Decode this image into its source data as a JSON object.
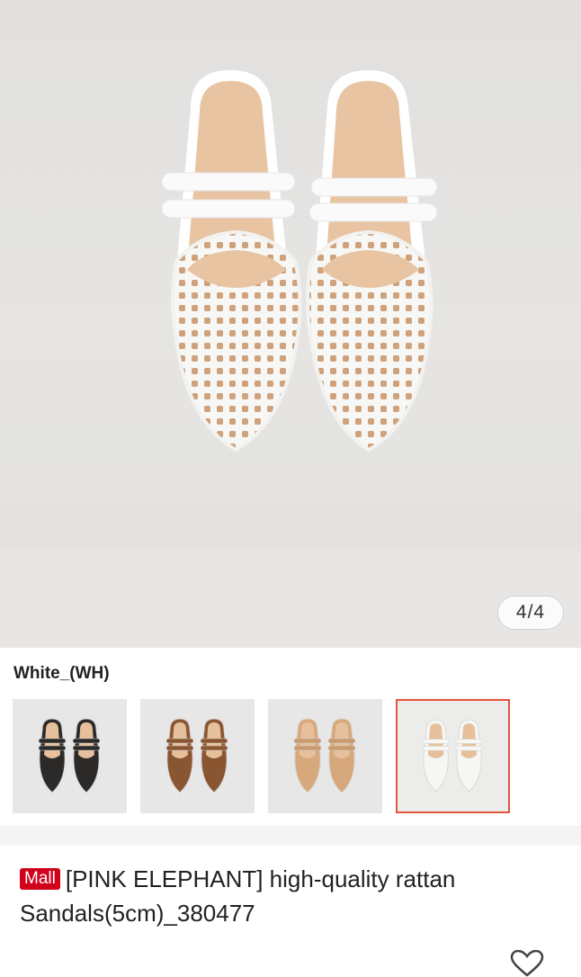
{
  "gallery": {
    "counter": "4/4",
    "image_alt": "white woven rattan mule sandals with double straps"
  },
  "variant": {
    "label": "White_(WH)",
    "options": [
      {
        "name": "black",
        "color": "#2b2a28",
        "strap": "#2b2a28",
        "selected": false
      },
      {
        "name": "brown",
        "color": "#8a5632",
        "strap": "#8a5632",
        "selected": false
      },
      {
        "name": "beige",
        "color": "#d7a87c",
        "strap": "#c99a6e",
        "selected": false
      },
      {
        "name": "white",
        "color": "#f6f6f4",
        "strap": "#f6f6f4",
        "selected": true
      }
    ]
  },
  "product": {
    "badge": "Mall",
    "title": "[PINK ELEPHANT] high-quality rattan Sandals(5cm)_380477"
  },
  "colors": {
    "accent": "#e4553b",
    "mall_red": "#d0011b",
    "hero_bg": "#e3e2e0"
  },
  "icons": {
    "wishlist": "heart-outline-icon"
  }
}
